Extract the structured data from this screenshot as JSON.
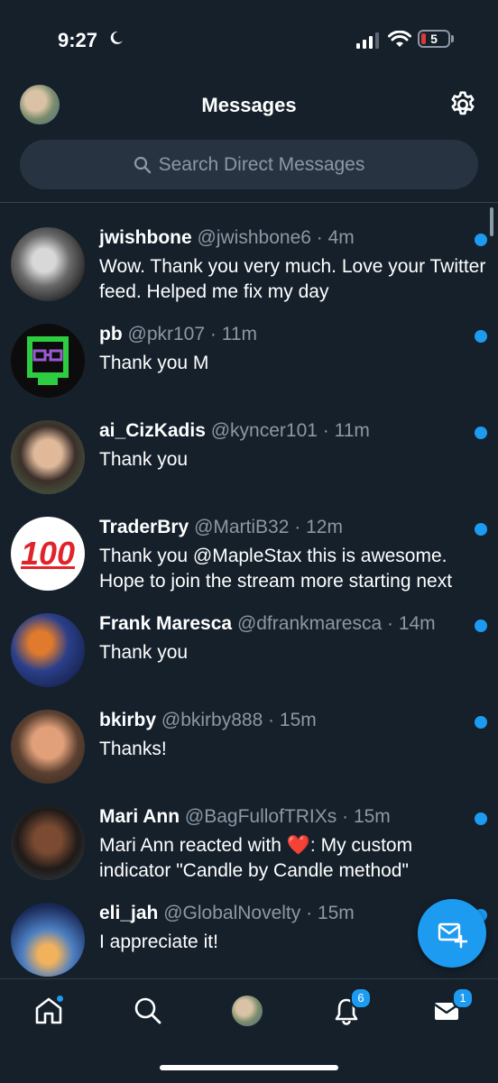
{
  "status_bar": {
    "time": "9:27",
    "battery": "5"
  },
  "header": {
    "title": "Messages"
  },
  "search": {
    "placeholder": "Search Direct Messages"
  },
  "conversations": [
    {
      "name": "jwishbone",
      "handle": "@jwishbone6",
      "time": "4m",
      "text": "Wow. Thank you very much. Love your Twitter feed. Helped me fix my day",
      "unread": true
    },
    {
      "name": "pb",
      "handle": "@pkr107",
      "time": "11m",
      "text": "Thank you M",
      "unread": true
    },
    {
      "name": "ai_CizKadis",
      "handle": "@kyncer101",
      "time": "11m",
      "text": "Thank you",
      "unread": true
    },
    {
      "name": "TraderBry",
      "handle": "@MartiB32",
      "time": "12m",
      "text": "Thank you @MapleStax  this is awesome. Hope to join the stream more starting next",
      "unread": true
    },
    {
      "name": "Frank Maresca",
      "handle": "@dfrankmaresca",
      "time": "14m",
      "text": "Thank you",
      "unread": true
    },
    {
      "name": "bkirby",
      "handle": "@bkirby888",
      "time": "15m",
      "text": "Thanks!",
      "unread": true
    },
    {
      "name": "Mari Ann",
      "handle": "@BagFullofTRIXs",
      "time": "15m",
      "text": "Mari Ann reacted with ❤️: My custom indicator \"Candle by Candle method\"",
      "unread": true
    },
    {
      "name": "eli_jah",
      "handle": "@GlobalNovelty",
      "time": "15m",
      "text": "I appreciate it!",
      "unread": true
    }
  ],
  "avatar_100_text": "100",
  "tabbar": {
    "notifications_badge": "6",
    "messages_badge": "1"
  },
  "colors": {
    "accent": "#1d9bf0",
    "background": "#15202b",
    "secondary_text": "#8b98a5"
  }
}
